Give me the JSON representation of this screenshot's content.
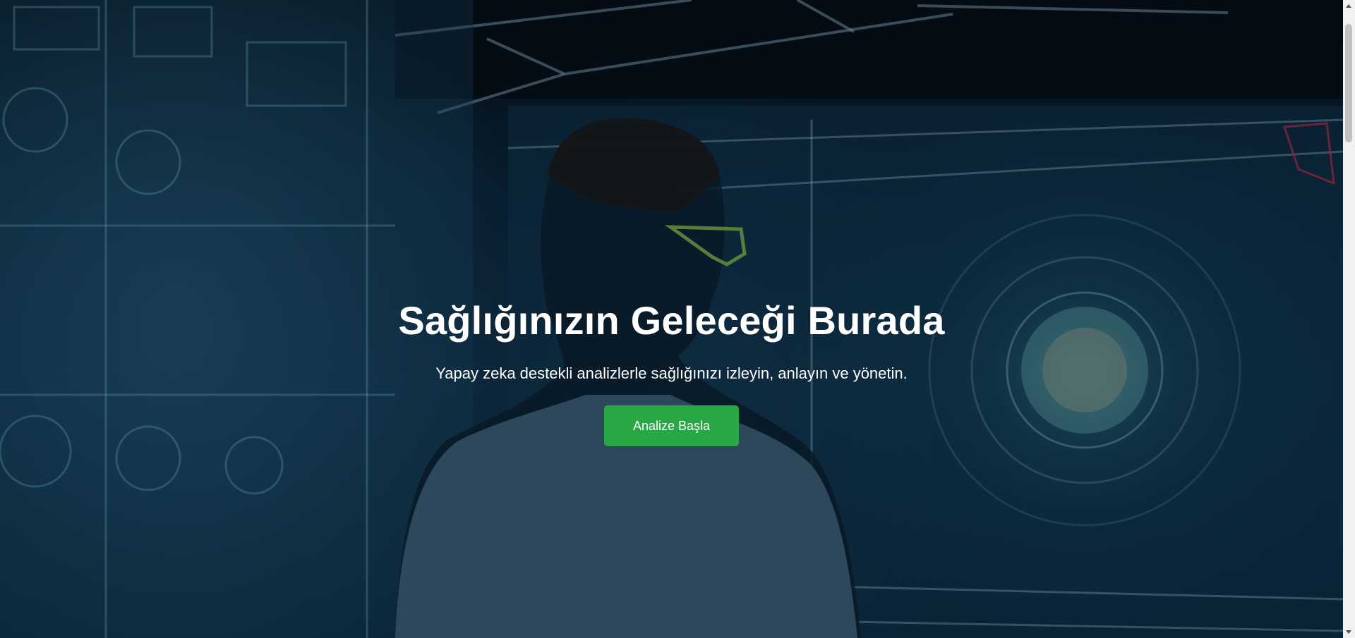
{
  "hero": {
    "title": "Sağlığınızın Geleceği Burada",
    "subtitle": "Yapay zeka destekli analizlerle sağlığınızı izleyin, anlayın ve yönetin.",
    "cta_label": "Analize Başla",
    "background_image": "scientist-viewing-holographic-medical-data",
    "colors": {
      "cta_background": "#28a745",
      "text": "#ffffff",
      "background_tone": "#0b2236"
    }
  }
}
